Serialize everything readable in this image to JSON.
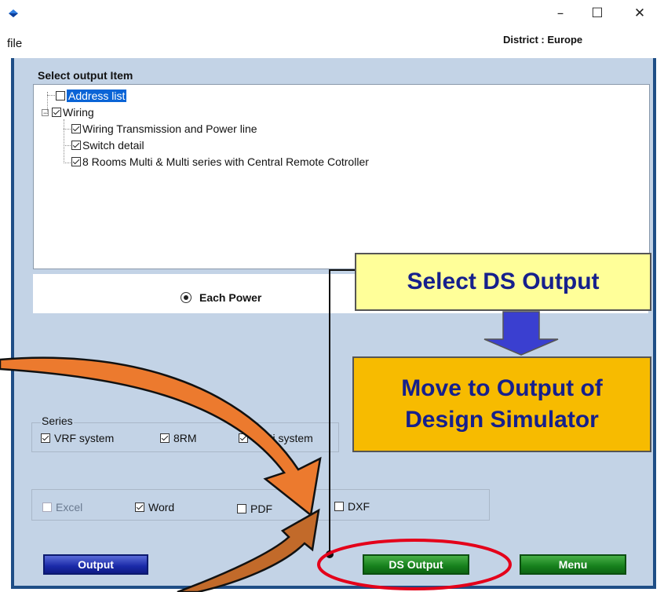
{
  "window": {
    "minimize_glyph": "–",
    "maximize_glyph": "☐",
    "close_glyph": "✕"
  },
  "menu": {
    "file": "file",
    "district": "District : Europe"
  },
  "select_output": {
    "title": "Select output Item",
    "items": [
      {
        "label": "Address list",
        "checked": false,
        "selected": true
      },
      {
        "label": "Wiring",
        "checked": true,
        "expanded": true
      },
      {
        "label": "Wiring Transmission and Power line",
        "checked": true
      },
      {
        "label": "Switch detail",
        "checked": true
      },
      {
        "label": "8 Rooms Multi & Multi series with Central Remote Cotroller",
        "checked": true
      }
    ]
  },
  "power": {
    "label": "Each Power",
    "selected": true
  },
  "series": {
    "title": "Series",
    "options": [
      {
        "label": "VRF system",
        "checked": true
      },
      {
        "label": "8RM",
        "checked": true
      },
      {
        "label": "Multi system",
        "checked": true
      }
    ]
  },
  "formats": [
    {
      "label": "Excel",
      "checked": false,
      "disabled": true
    },
    {
      "label": "Word",
      "checked": true
    },
    {
      "label": "PDF",
      "checked": false
    },
    {
      "label": "DXF",
      "checked": false
    }
  ],
  "buttons": {
    "output": "Output",
    "ds_output": "DS Output",
    "menu": "Menu"
  },
  "annotations": {
    "select_ds": "Select DS Output",
    "move_line1": "Move to Output of",
    "move_line2": "Design Simulator",
    "colors": {
      "callout_yellow": "#ffff99",
      "callout_orange": "#f7bb00",
      "text_blue": "#16208c",
      "highlight_red": "#e4001a"
    }
  }
}
